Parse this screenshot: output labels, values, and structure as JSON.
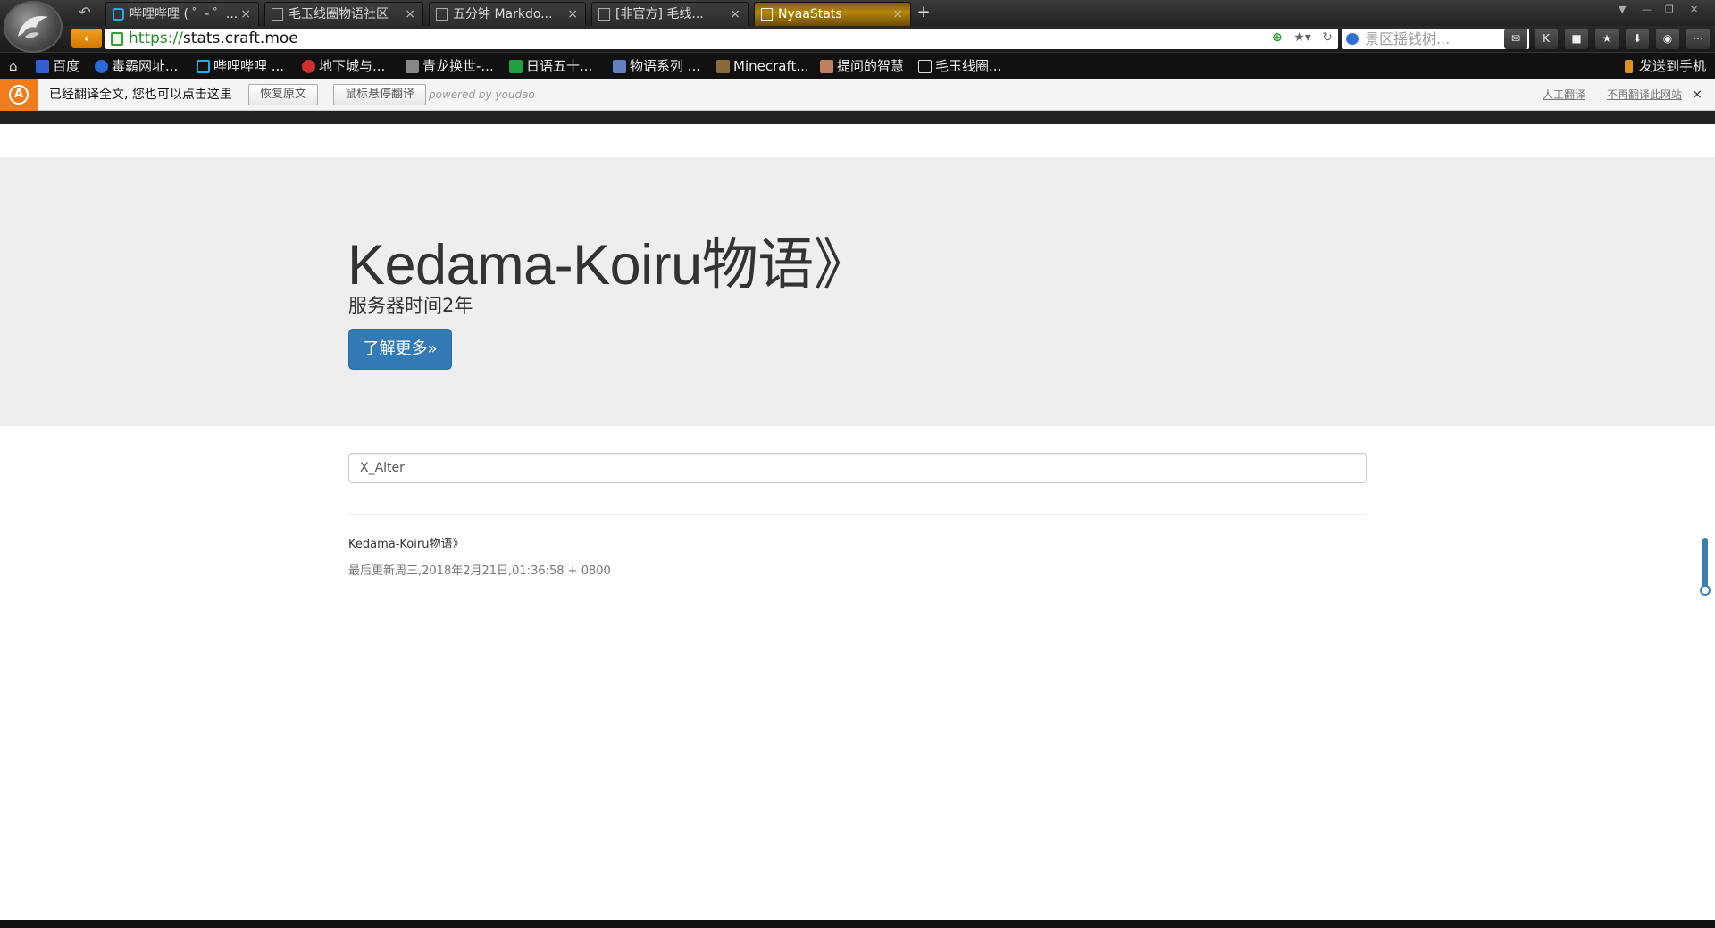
{
  "browser": {
    "tabs": [
      {
        "label": "哔哩哔哩 ( ゜- ゜...",
        "icon": "bilibili-icon"
      },
      {
        "label": "毛玉线圈物语社区",
        "icon": "page-icon"
      },
      {
        "label": "五分钟 Markdo...",
        "icon": "page-icon"
      },
      {
        "label": "[非官方] 毛线...",
        "icon": "page-icon"
      },
      {
        "label": "NyaaStats",
        "icon": "page-icon"
      }
    ],
    "active_tab": "NyaaStats",
    "close_glyph": "×",
    "new_tab_glyph": "+",
    "url_protocol": "https://",
    "url_host": "stats.craft.moe",
    "search_placeholder": "景区摇钱树..."
  },
  "bookmarks": [
    {
      "label": "百度",
      "color": "#3060d0"
    },
    {
      "label": "毒霸网址...",
      "color": "#2a6ad8"
    },
    {
      "label": "哔哩哔哩 ...",
      "color": "#23ade5"
    },
    {
      "label": "地下城与...",
      "color": "#d03030"
    },
    {
      "label": "青龙换世-...",
      "color": "#888888"
    },
    {
      "label": "日语五十...",
      "color": "#20a040"
    },
    {
      "label": "物语系列 ...",
      "color": "#6080c0"
    },
    {
      "label": "Minecraft...",
      "color": "#8a6a3a"
    },
    {
      "label": "提问的智慧",
      "color": "#c08060"
    },
    {
      "label": "毛玉线圈...",
      "color": "#dddddd"
    }
  ],
  "bookmark_send": "发送到手机",
  "translate_bar": {
    "message": "已经翻译全文, 您也可以点击这里",
    "restore_button": "恢复原文",
    "hover_button": "鼠标悬停翻译",
    "powered": "powered by youdao",
    "human_translate": "人工翻译",
    "never_translate": "不再翻译此网站",
    "close": "×"
  },
  "page": {
    "title": "Kedama-Koiru物语》",
    "subtitle": "服务器时间2年",
    "learn_more": "了解更多»",
    "search_value": "X_Alter",
    "result_name": "Kedama-Koiru物语》",
    "result_updated": "最后更新周三,2018年2月21日,01:36:58 + 0800"
  },
  "colors": {
    "accent": "#337ab7",
    "jumbotron_bg": "#eeeeee",
    "active_tab": "#b8860b"
  }
}
